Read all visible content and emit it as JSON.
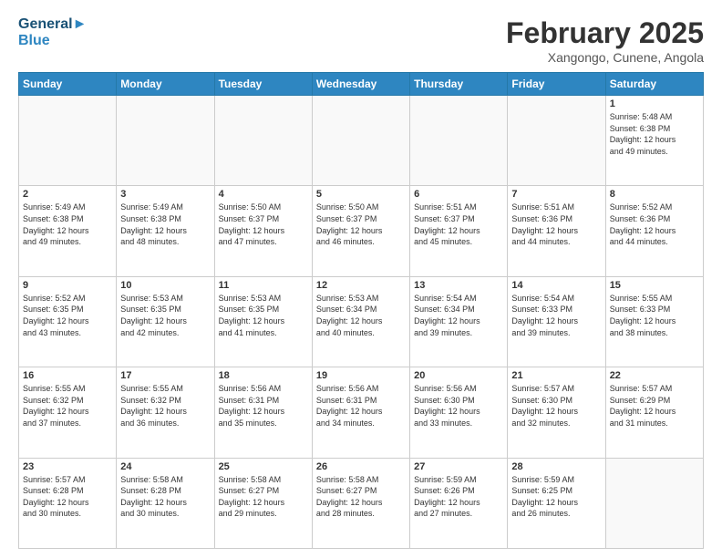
{
  "header": {
    "logo_line1": "General",
    "logo_line2": "Blue",
    "month": "February 2025",
    "location": "Xangongo, Cunene, Angola"
  },
  "weekdays": [
    "Sunday",
    "Monday",
    "Tuesday",
    "Wednesday",
    "Thursday",
    "Friday",
    "Saturday"
  ],
  "weeks": [
    [
      {
        "day": "",
        "info": ""
      },
      {
        "day": "",
        "info": ""
      },
      {
        "day": "",
        "info": ""
      },
      {
        "day": "",
        "info": ""
      },
      {
        "day": "",
        "info": ""
      },
      {
        "day": "",
        "info": ""
      },
      {
        "day": "1",
        "info": "Sunrise: 5:48 AM\nSunset: 6:38 PM\nDaylight: 12 hours\nand 49 minutes."
      }
    ],
    [
      {
        "day": "2",
        "info": "Sunrise: 5:49 AM\nSunset: 6:38 PM\nDaylight: 12 hours\nand 49 minutes."
      },
      {
        "day": "3",
        "info": "Sunrise: 5:49 AM\nSunset: 6:38 PM\nDaylight: 12 hours\nand 48 minutes."
      },
      {
        "day": "4",
        "info": "Sunrise: 5:50 AM\nSunset: 6:37 PM\nDaylight: 12 hours\nand 47 minutes."
      },
      {
        "day": "5",
        "info": "Sunrise: 5:50 AM\nSunset: 6:37 PM\nDaylight: 12 hours\nand 46 minutes."
      },
      {
        "day": "6",
        "info": "Sunrise: 5:51 AM\nSunset: 6:37 PM\nDaylight: 12 hours\nand 45 minutes."
      },
      {
        "day": "7",
        "info": "Sunrise: 5:51 AM\nSunset: 6:36 PM\nDaylight: 12 hours\nand 44 minutes."
      },
      {
        "day": "8",
        "info": "Sunrise: 5:52 AM\nSunset: 6:36 PM\nDaylight: 12 hours\nand 44 minutes."
      }
    ],
    [
      {
        "day": "9",
        "info": "Sunrise: 5:52 AM\nSunset: 6:35 PM\nDaylight: 12 hours\nand 43 minutes."
      },
      {
        "day": "10",
        "info": "Sunrise: 5:53 AM\nSunset: 6:35 PM\nDaylight: 12 hours\nand 42 minutes."
      },
      {
        "day": "11",
        "info": "Sunrise: 5:53 AM\nSunset: 6:35 PM\nDaylight: 12 hours\nand 41 minutes."
      },
      {
        "day": "12",
        "info": "Sunrise: 5:53 AM\nSunset: 6:34 PM\nDaylight: 12 hours\nand 40 minutes."
      },
      {
        "day": "13",
        "info": "Sunrise: 5:54 AM\nSunset: 6:34 PM\nDaylight: 12 hours\nand 39 minutes."
      },
      {
        "day": "14",
        "info": "Sunrise: 5:54 AM\nSunset: 6:33 PM\nDaylight: 12 hours\nand 39 minutes."
      },
      {
        "day": "15",
        "info": "Sunrise: 5:55 AM\nSunset: 6:33 PM\nDaylight: 12 hours\nand 38 minutes."
      }
    ],
    [
      {
        "day": "16",
        "info": "Sunrise: 5:55 AM\nSunset: 6:32 PM\nDaylight: 12 hours\nand 37 minutes."
      },
      {
        "day": "17",
        "info": "Sunrise: 5:55 AM\nSunset: 6:32 PM\nDaylight: 12 hours\nand 36 minutes."
      },
      {
        "day": "18",
        "info": "Sunrise: 5:56 AM\nSunset: 6:31 PM\nDaylight: 12 hours\nand 35 minutes."
      },
      {
        "day": "19",
        "info": "Sunrise: 5:56 AM\nSunset: 6:31 PM\nDaylight: 12 hours\nand 34 minutes."
      },
      {
        "day": "20",
        "info": "Sunrise: 5:56 AM\nSunset: 6:30 PM\nDaylight: 12 hours\nand 33 minutes."
      },
      {
        "day": "21",
        "info": "Sunrise: 5:57 AM\nSunset: 6:30 PM\nDaylight: 12 hours\nand 32 minutes."
      },
      {
        "day": "22",
        "info": "Sunrise: 5:57 AM\nSunset: 6:29 PM\nDaylight: 12 hours\nand 31 minutes."
      }
    ],
    [
      {
        "day": "23",
        "info": "Sunrise: 5:57 AM\nSunset: 6:28 PM\nDaylight: 12 hours\nand 30 minutes."
      },
      {
        "day": "24",
        "info": "Sunrise: 5:58 AM\nSunset: 6:28 PM\nDaylight: 12 hours\nand 30 minutes."
      },
      {
        "day": "25",
        "info": "Sunrise: 5:58 AM\nSunset: 6:27 PM\nDaylight: 12 hours\nand 29 minutes."
      },
      {
        "day": "26",
        "info": "Sunrise: 5:58 AM\nSunset: 6:27 PM\nDaylight: 12 hours\nand 28 minutes."
      },
      {
        "day": "27",
        "info": "Sunrise: 5:59 AM\nSunset: 6:26 PM\nDaylight: 12 hours\nand 27 minutes."
      },
      {
        "day": "28",
        "info": "Sunrise: 5:59 AM\nSunset: 6:25 PM\nDaylight: 12 hours\nand 26 minutes."
      },
      {
        "day": "",
        "info": ""
      }
    ]
  ]
}
